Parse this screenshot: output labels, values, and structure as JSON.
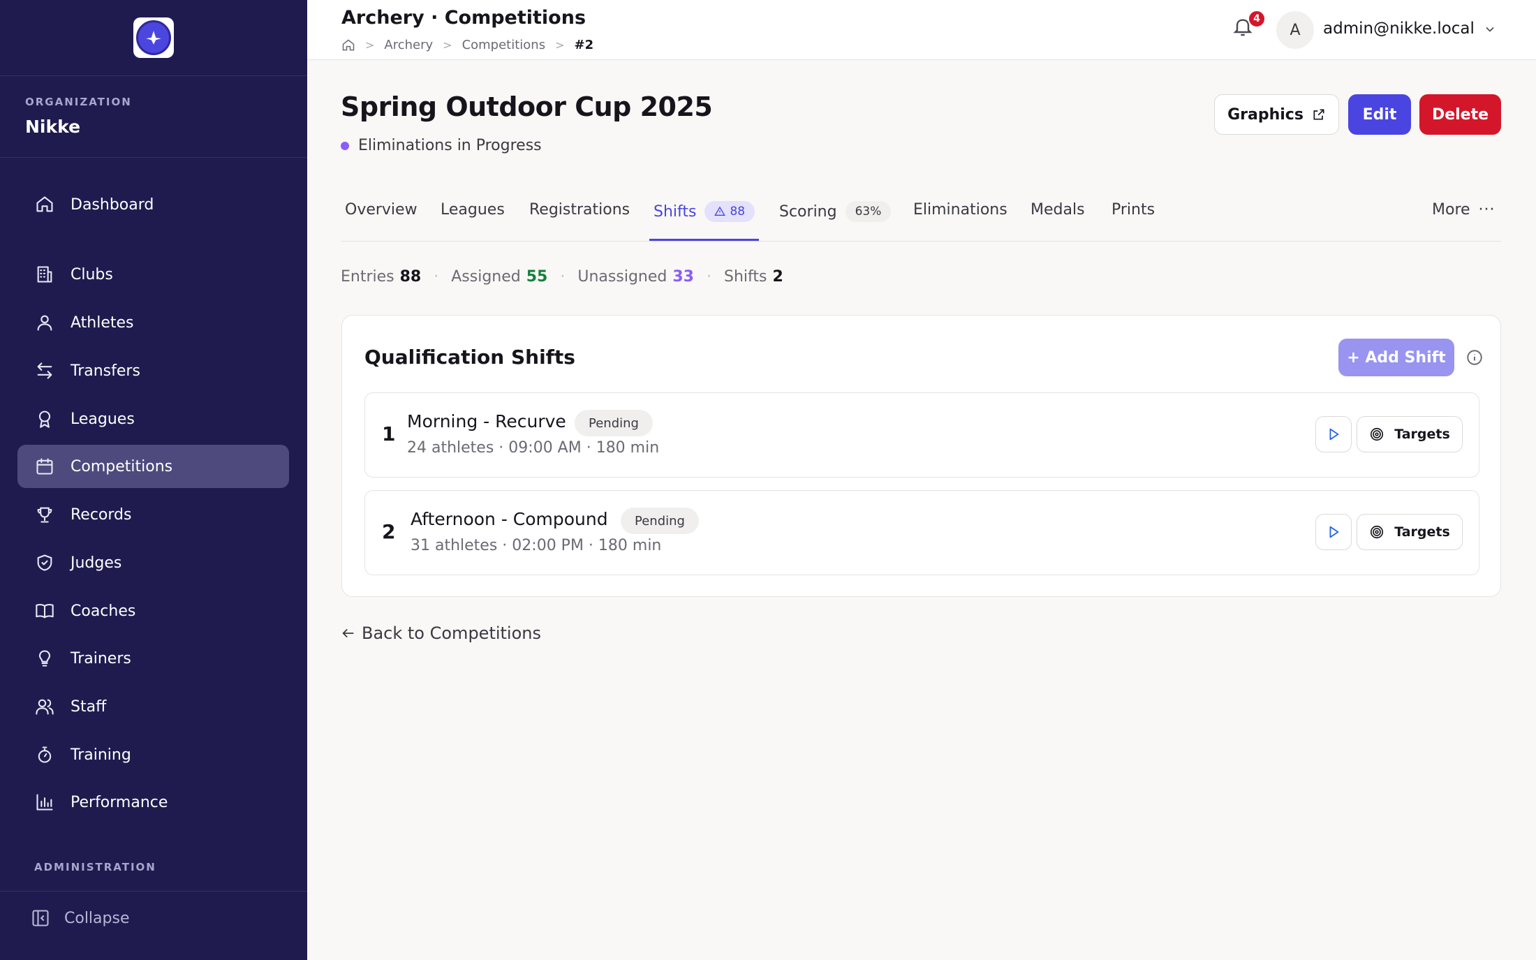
{
  "header": {
    "title": "Archery · Competitions",
    "breadcrumbs": [
      "Archery",
      "Competitions",
      "#2"
    ],
    "notifications_count": "4",
    "avatar_initial": "A",
    "user_email": "admin@nikke.local"
  },
  "sidebar": {
    "org_label": "ORGANIZATION",
    "org_name": "Nikke",
    "items": [
      {
        "label": "Dashboard",
        "icon": "home-icon"
      },
      {
        "label": "Clubs",
        "icon": "building-icon"
      },
      {
        "label": "Athletes",
        "icon": "user-icon"
      },
      {
        "label": "Transfers",
        "icon": "arrows-icon"
      },
      {
        "label": "Leagues",
        "icon": "award-icon"
      },
      {
        "label": "Competitions",
        "icon": "calendar-icon",
        "active": true
      },
      {
        "label": "Records",
        "icon": "trophy-icon"
      },
      {
        "label": "Judges",
        "icon": "shield-check-icon"
      },
      {
        "label": "Coaches",
        "icon": "book-icon"
      },
      {
        "label": "Trainers",
        "icon": "lightbulb-icon"
      },
      {
        "label": "Staff",
        "icon": "users-icon"
      },
      {
        "label": "Training",
        "icon": "stopwatch-icon"
      },
      {
        "label": "Performance",
        "icon": "bar-chart-icon"
      }
    ],
    "admin_label": "ADMINISTRATION",
    "collapse_label": "Collapse"
  },
  "main": {
    "title": "Spring Outdoor Cup 2025",
    "status": "Eliminations in Progress",
    "status_color": "#8b5cf6",
    "buttons": {
      "graphics": "Graphics",
      "edit": "Edit",
      "delete": "Delete"
    },
    "tabs": [
      {
        "label": "Overview"
      },
      {
        "label": "Leagues"
      },
      {
        "label": "Registrations"
      },
      {
        "label": "Shifts",
        "badge": "88",
        "active": true
      },
      {
        "label": "Scoring",
        "badge": "63%"
      },
      {
        "label": "Eliminations"
      },
      {
        "label": "Medals"
      },
      {
        "label": "Prints"
      }
    ],
    "more_label": "More",
    "stats": [
      {
        "label": "Entries",
        "value": "88"
      },
      {
        "label": "Assigned",
        "value": "55"
      },
      {
        "label": "Unassigned",
        "value": "33"
      },
      {
        "label": "Shifts",
        "value": "2"
      }
    ],
    "card": {
      "title": "Qualification Shifts",
      "add_label": "+ Add Shift",
      "targets_label": "Targets",
      "shifts": [
        {
          "num": "1",
          "name": "Morning - Recurve",
          "status": "Pending",
          "meta": "24 athletes · 09:00 AM · 180 min"
        },
        {
          "num": "2",
          "name": "Afternoon - Compound",
          "status": "Pending",
          "meta": "31 athletes · 02:00 PM · 180 min"
        }
      ]
    },
    "back_label": "Back to Competitions"
  },
  "colors": {
    "sidebar_bg": "#1f1b4f",
    "accent": "#4a45e0",
    "danger": "#d4162b",
    "success": "#15803d"
  }
}
